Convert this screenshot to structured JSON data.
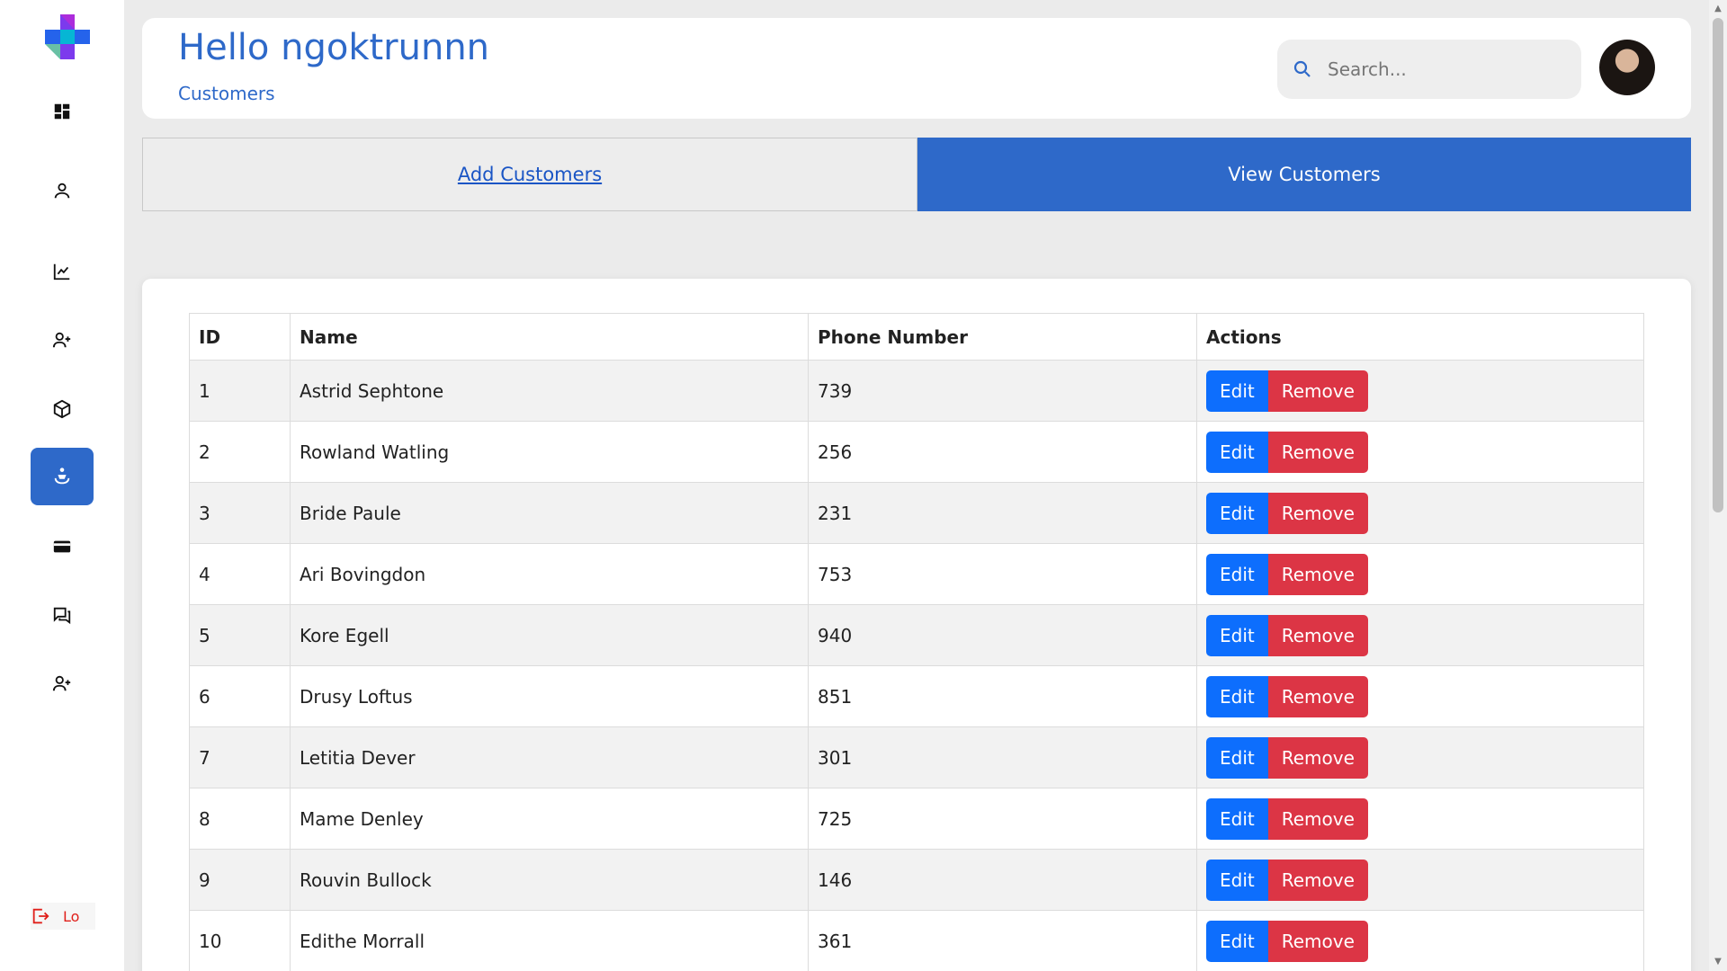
{
  "header": {
    "greeting": "Hello ngoktrunnn",
    "breadcrumb": "Customers",
    "search_placeholder": "Search..."
  },
  "sidebar": {
    "items": [
      {
        "icon": "dashboard-icon"
      },
      {
        "icon": "user-icon"
      },
      {
        "icon": "chart-icon"
      },
      {
        "icon": "user-add-icon"
      },
      {
        "icon": "box-icon"
      },
      {
        "icon": "customer-icon",
        "active": true
      },
      {
        "icon": "credit-card-icon"
      },
      {
        "icon": "chat-icon"
      },
      {
        "icon": "user-add-icon"
      }
    ],
    "logout_label": "Lo"
  },
  "tabs": {
    "add_label": "Add Customers",
    "view_label": "View Customers"
  },
  "table": {
    "headers": [
      "ID",
      "Name",
      "Phone Number",
      "Actions"
    ],
    "edit_label": "Edit",
    "remove_label": "Remove",
    "rows": [
      {
        "id": "1",
        "name": "Astrid Sephtone",
        "phone": "739"
      },
      {
        "id": "2",
        "name": "Rowland Watling",
        "phone": "256"
      },
      {
        "id": "3",
        "name": "Bride Paule",
        "phone": "231"
      },
      {
        "id": "4",
        "name": "Ari Bovingdon",
        "phone": "753"
      },
      {
        "id": "5",
        "name": "Kore Egell",
        "phone": "940"
      },
      {
        "id": "6",
        "name": "Drusy Loftus",
        "phone": "851"
      },
      {
        "id": "7",
        "name": "Letitia Dever",
        "phone": "301"
      },
      {
        "id": "8",
        "name": "Mame Denley",
        "phone": "725"
      },
      {
        "id": "9",
        "name": "Rouvin Bullock",
        "phone": "146"
      },
      {
        "id": "10",
        "name": "Edithe Morrall",
        "phone": "361"
      }
    ]
  },
  "colors": {
    "accent": "#2e69c9",
    "edit": "#0d6efd",
    "remove": "#dc3545"
  }
}
